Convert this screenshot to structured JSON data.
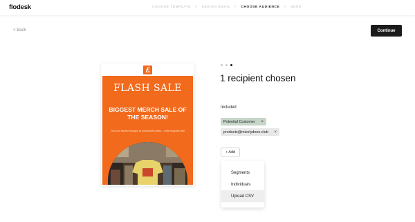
{
  "app": {
    "logo": "flodesk"
  },
  "steps": [
    {
      "label": "CHOOSE TEMPLATE",
      "active": false
    },
    {
      "label": "DESIGN EMAIL",
      "active": false
    },
    {
      "label": "CHOOSE AUDIENCE",
      "active": true
    },
    {
      "label": "SEND",
      "active": false
    }
  ],
  "step_separator": ">",
  "nav": {
    "back_label": "< Back",
    "continue_label": "Continue"
  },
  "preview": {
    "headline": "FLASH SALE",
    "subheadline": "BIGGEST MERCH SALE OF THE SEASON!",
    "blurb": "Get your favorite designs at unbeatable prices – while supplies last!",
    "brand_color": "#f26a1b",
    "logo_icon": "flodesk-logo-icon",
    "photo": "merch-store-photo"
  },
  "audience": {
    "step_dots": {
      "total": 3,
      "current": 3
    },
    "title": "1 recipient chosen",
    "included_label": "Included",
    "chips": [
      {
        "label": "Potential Customer",
        "color": "#c7d6c9"
      },
      {
        "label": "products@micelydone.club",
        "color": "#e8e8e8"
      }
    ],
    "remove_icon": "×",
    "add_label": "+ Add",
    "add_menu": {
      "items": [
        "Segments",
        "Individuals",
        "Upload CSV"
      ],
      "highlighted": "Upload CSV"
    }
  }
}
